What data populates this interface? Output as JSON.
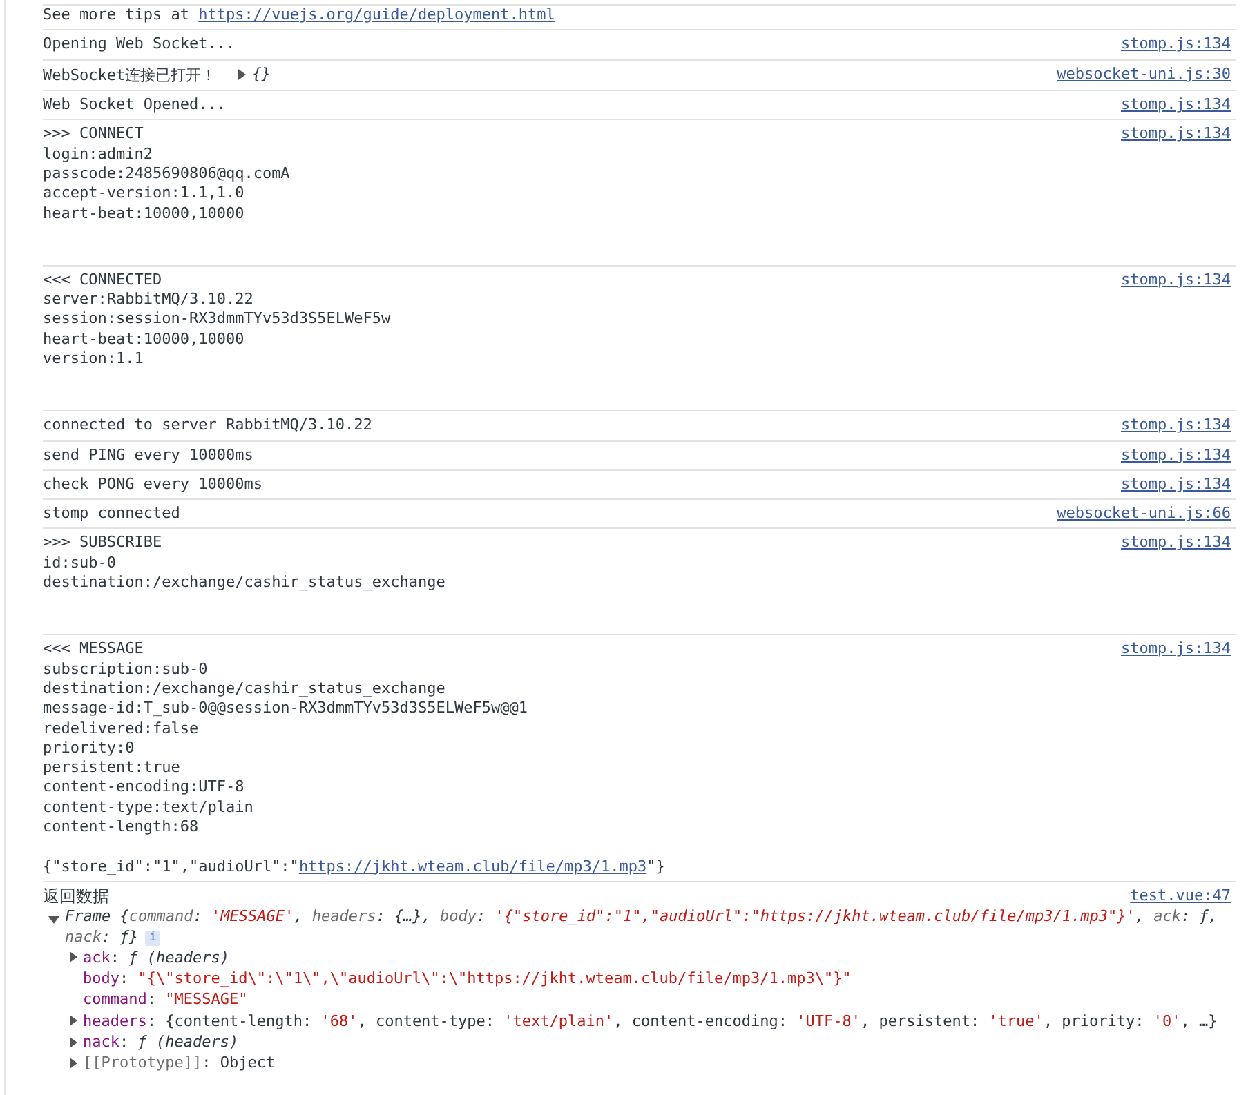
{
  "console": {
    "messages": [
      {
        "kind": "text",
        "text": "See more tips at ",
        "link": "https://vuejs.org/guide/deployment.html"
      },
      {
        "kind": "text",
        "text": "Opening Web Socket...",
        "source": "stomp.js:134"
      },
      {
        "kind": "text",
        "text": "WebSocket连接已打开！",
        "object_preview": {
          "text": "{}",
          "expanded": false
        },
        "source": "websocket-uni.js:30"
      },
      {
        "kind": "text",
        "text": "Web Socket Opened...",
        "source": "stomp.js:134"
      },
      {
        "kind": "frame",
        "lines": [
          ">>> CONNECT",
          "login:admin2",
          "passcode:2485690806@qq.comA",
          "accept-version:1.1,1.0",
          "heart-beat:10000,10000"
        ],
        "source": "stomp.js:134"
      },
      {
        "kind": "frame",
        "lines": [
          "<<< CONNECTED",
          "server:RabbitMQ/3.10.22",
          "session:session-RX3dmmTYv53d3S5ELWeF5w",
          "heart-beat:10000,10000",
          "version:1.1"
        ],
        "source": "stomp.js:134"
      },
      {
        "kind": "text",
        "text": "connected to server RabbitMQ/3.10.22",
        "source": "stomp.js:134"
      },
      {
        "kind": "text",
        "text": "send PING every 10000ms",
        "source": "stomp.js:134"
      },
      {
        "kind": "text",
        "text": "check PONG every 10000ms",
        "source": "stomp.js:134"
      },
      {
        "kind": "text",
        "text": "stomp connected",
        "source": "websocket-uni.js:66"
      },
      {
        "kind": "frame",
        "lines": [
          ">>> SUBSCRIBE",
          "id:sub-0",
          "destination:/exchange/cashir_status_exchange"
        ],
        "source": "stomp.js:134"
      },
      {
        "kind": "frame",
        "lines": [
          "<<< MESSAGE",
          "subscription:sub-0",
          "destination:/exchange/cashir_status_exchange",
          "message-id:T_sub-0@@session-RX3dmmTYv53d3S5ELWeF5w@@1",
          "redelivered:false",
          "priority:0",
          "persistent:true",
          "content-encoding:UTF-8",
          "content-type:text/plain",
          "content-length:68"
        ],
        "body": [
          {
            "text": "{\"store_id\":\"1\",\"audioUrl\":\"",
            "kind": "plain"
          },
          {
            "text": "https://jkht.wteam.club/file/mp3/1.mp3",
            "kind": "link"
          },
          {
            "text": "\"}",
            "kind": "plain"
          }
        ],
        "source": "stomp.js:134"
      },
      {
        "kind": "object",
        "text": "返回数据",
        "source": "test.vue:47",
        "object": {
          "expanded": true,
          "separator": ":",
          "summary": [
            {
              "text": "Frame {",
              "kind": "plain"
            },
            {
              "text": "command",
              "kind": "key"
            },
            {
              "text": ": ",
              "kind": "plain"
            },
            {
              "text": "'MESSAGE'",
              "kind": "string"
            },
            {
              "text": ", ",
              "kind": "plain"
            },
            {
              "text": "headers",
              "kind": "key"
            },
            {
              "text": ": {…}, ",
              "kind": "plain"
            },
            {
              "text": "body",
              "kind": "key"
            },
            {
              "text": ": ",
              "kind": "plain"
            },
            {
              "text": "'{\"store_id\":\"1\",\"audioUrl\":\"https://jkht.wteam.club/file/mp3/1.mp3\"}'",
              "kind": "string"
            },
            {
              "text": ", ",
              "kind": "plain"
            },
            {
              "text": "ack",
              "kind": "key"
            },
            {
              "text": ": ƒ, ",
              "kind": "plain"
            },
            {
              "text": "nack",
              "kind": "key"
            },
            {
              "text": ": ƒ}",
              "kind": "plain"
            }
          ],
          "info_badge": "i",
          "properties": [
            {
              "key": "ack",
              "expanded": false,
              "value": [
                {
                  "text": "ƒ (headers)",
                  "kind": "func"
                }
              ]
            },
            {
              "key": "body",
              "value": [
                {
                  "text": "\"{\\\"store_id\\\":\\\"1\\\",\\\"audioUrl\\\":\\\"https://jkht.wteam.club/file/mp3/1.mp3\\\"}\"",
                  "kind": "string"
                }
              ]
            },
            {
              "key": "command",
              "value": [
                {
                  "text": "\"MESSAGE\"",
                  "kind": "string"
                }
              ]
            },
            {
              "key": "headers",
              "expanded": false,
              "value": [
                {
                  "text": "{content-length: ",
                  "kind": "plain"
                },
                {
                  "text": "'68'",
                  "kind": "string"
                },
                {
                  "text": ", content-type: ",
                  "kind": "plain"
                },
                {
                  "text": "'text/plain'",
                  "kind": "string"
                },
                {
                  "text": ", content-encoding: ",
                  "kind": "plain"
                },
                {
                  "text": "'UTF-8'",
                  "kind": "string"
                },
                {
                  "text": ", persistent: ",
                  "kind": "plain"
                },
                {
                  "text": "'true'",
                  "kind": "string"
                },
                {
                  "text": ", priority: ",
                  "kind": "plain"
                },
                {
                  "text": "'0'",
                  "kind": "string"
                },
                {
                  "text": ", …}",
                  "kind": "plain"
                }
              ]
            },
            {
              "key": "nack",
              "expanded": false,
              "value": [
                {
                  "text": "ƒ (headers)",
                  "kind": "func"
                }
              ]
            },
            {
              "key": "[[Prototype]]",
              "internal": true,
              "expanded": false,
              "value": [
                {
                  "text": "Object",
                  "kind": "plain"
                }
              ]
            }
          ]
        }
      }
    ]
  }
}
